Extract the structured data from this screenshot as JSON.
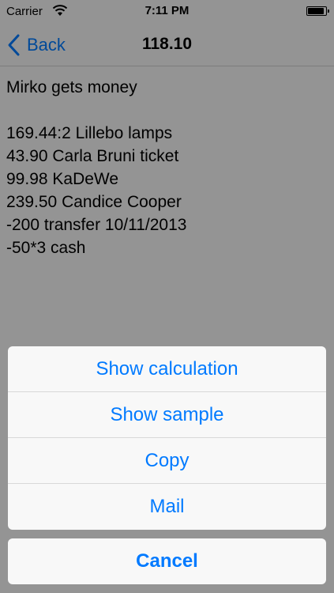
{
  "status_bar": {
    "carrier": "Carrier",
    "time": "7:11 PM",
    "battery_level": 1.0
  },
  "nav": {
    "back_label": "Back",
    "title": "118.10"
  },
  "content": {
    "lines": [
      "Mirko gets money",
      "",
      "169.44:2 Lillebo lamps",
      "43.90 Carla Bruni ticket",
      "99.98 KaDeWe",
      "239.50 Candice Cooper",
      "-200 transfer 10/11/2013",
      "-50*3 cash"
    ]
  },
  "action_sheet": {
    "items": [
      {
        "label": "Show calculation"
      },
      {
        "label": "Show sample"
      },
      {
        "label": "Copy"
      },
      {
        "label": "Mail"
      }
    ],
    "cancel_label": "Cancel"
  },
  "colors": {
    "accent": "#007aff",
    "overlay": "rgba(0,0,0,0.4)"
  },
  "icons": {
    "back": "chevron-left-icon",
    "wifi": "wifi-icon",
    "battery": "battery-icon"
  }
}
